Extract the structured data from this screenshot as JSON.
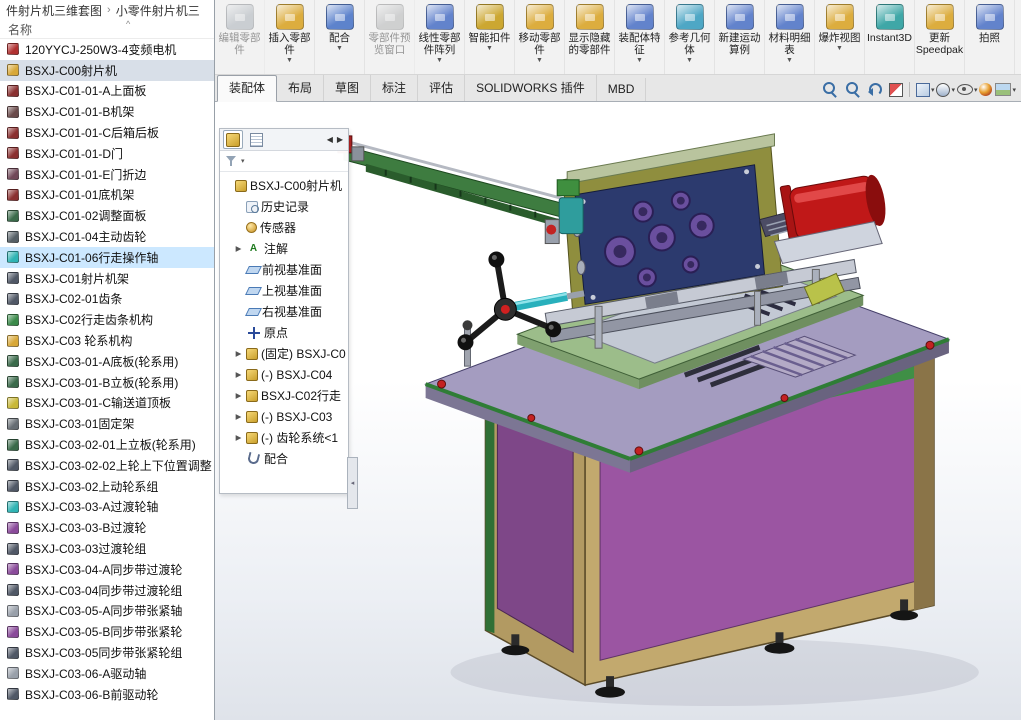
{
  "explorer": {
    "breadcrumb": {
      "seg1": "件射片机三维套图",
      "sep": "›",
      "seg2": "小零件射片机三"
    },
    "name_header": "名称",
    "sort_indicator": "^",
    "files": [
      {
        "label": "120YYCJ-250W3-4变频电机",
        "icon": "part-icon",
        "icon_color": "#b03030",
        "state": "normal"
      },
      {
        "label": "BSXJ-C00射片机",
        "icon": "assembly-icon",
        "icon_color": "#d8a838",
        "state": "selgray"
      },
      {
        "label": "BSXJ-C01-01-A上面板",
        "icon": "part-icon",
        "icon_color": "#8a3030",
        "state": "normal"
      },
      {
        "label": "BSXJ-C01-01-B机架",
        "icon": "part-icon",
        "icon_color": "#6a4a4a",
        "state": "normal"
      },
      {
        "label": "BSXJ-C01-01-C后箱后板",
        "icon": "part-icon",
        "icon_color": "#8a3030",
        "state": "normal"
      },
      {
        "label": "BSXJ-C01-01-D门",
        "icon": "part-icon",
        "icon_color": "#8a3030",
        "state": "normal"
      },
      {
        "label": "BSXJ-C01-01-E门折边",
        "icon": "part-icon",
        "icon_color": "#704858",
        "state": "normal"
      },
      {
        "label": "BSXJ-C01-01底机架",
        "icon": "part-icon",
        "icon_color": "#8a3030",
        "state": "normal"
      },
      {
        "label": "BSXJ-C01-02调整面板",
        "icon": "part-icon",
        "icon_color": "#3a6a4a",
        "state": "normal"
      },
      {
        "label": "BSXJ-C01-04主动齿轮",
        "icon": "part-icon",
        "icon_color": "#555f66",
        "state": "normal"
      },
      {
        "label": "BSXJ-C01-06行走操作轴",
        "icon": "part-icon",
        "icon_color": "#2fb3b3",
        "state": "selected"
      },
      {
        "label": "BSXJ-C01射片机架",
        "icon": "part-icon",
        "icon_color": "#505866",
        "state": "normal"
      },
      {
        "label": "BSXJ-C02-01齿条",
        "icon": "part-icon",
        "icon_color": "#505866",
        "state": "normal"
      },
      {
        "label": "BSXJ-C02行走齿条机构",
        "icon": "assembly-icon",
        "icon_color": "#3a8a4a",
        "state": "normal"
      },
      {
        "label": "BSXJ-C03 轮系机构",
        "icon": "assembly-icon",
        "icon_color": "#d8a838",
        "state": "normal"
      },
      {
        "label": "BSXJ-C03-01-A底板(轮系用)",
        "icon": "part-icon",
        "icon_color": "#3a6a4a",
        "state": "normal"
      },
      {
        "label": "BSXJ-C03-01-B立板(轮系用)",
        "icon": "part-icon",
        "icon_color": "#3a6a4a",
        "state": "normal"
      },
      {
        "label": "BSXJ-C03-01-C输送道顶板",
        "icon": "part-icon",
        "icon_color": "#c8b838",
        "state": "normal"
      },
      {
        "label": "BSXJ-C03-01固定架",
        "icon": "part-icon",
        "icon_color": "#666d73",
        "state": "normal"
      },
      {
        "label": "BSXJ-C03-02-01上立板(轮系用)",
        "icon": "part-icon",
        "icon_color": "#3a6a4a",
        "state": "normal"
      },
      {
        "label": "BSXJ-C03-02-02上轮上下位置调整",
        "icon": "part-icon",
        "icon_color": "#505866",
        "state": "normal"
      },
      {
        "label": "BSXJ-C03-02上动轮系组",
        "icon": "part-icon",
        "icon_color": "#505866",
        "state": "normal"
      },
      {
        "label": "BSXJ-C03-03-A过渡轮轴",
        "icon": "part-icon",
        "icon_color": "#2fb3b3",
        "state": "normal"
      },
      {
        "label": "BSXJ-C03-03-B过渡轮",
        "icon": "part-icon",
        "icon_color": "#8a4a9a",
        "state": "normal"
      },
      {
        "label": "BSXJ-C03-03过渡轮组",
        "icon": "part-icon",
        "icon_color": "#505866",
        "state": "normal"
      },
      {
        "label": "BSXJ-C03-04-A同步带过渡轮",
        "icon": "part-icon",
        "icon_color": "#8a4a9a",
        "state": "normal"
      },
      {
        "label": "BSXJ-C03-04同步带过渡轮组",
        "icon": "part-icon",
        "icon_color": "#505866",
        "state": "normal"
      },
      {
        "label": "BSXJ-C03-05-A同步带张紧轴",
        "icon": "part-icon",
        "icon_color": "#99a0aa",
        "state": "normal"
      },
      {
        "label": "BSXJ-C03-05-B同步带张紧轮",
        "icon": "part-icon",
        "icon_color": "#8a4a9a",
        "state": "normal"
      },
      {
        "label": "BSXJ-C03-05同步带张紧轮组",
        "icon": "part-icon",
        "icon_color": "#505866",
        "state": "normal"
      },
      {
        "label": "BSXJ-C03-06-A驱动轴",
        "icon": "part-icon",
        "icon_color": "#99a0aa",
        "state": "normal"
      },
      {
        "label": "BSXJ-C03-06-B前驱动轮",
        "icon": "part-icon",
        "icon_color": "#505866",
        "state": "normal"
      }
    ]
  },
  "ribbon": {
    "buttons": [
      {
        "name": "edit-component-button",
        "label": "编辑零部件",
        "arrow": "",
        "state": "disabled",
        "icon_color": "#7f9fbf"
      },
      {
        "name": "insert-components-button",
        "label": "插入零部件",
        "arrow": "▼",
        "state": "",
        "icon_color": "#d9a62e"
      },
      {
        "name": "mate-button",
        "label": "配合",
        "arrow": "▼",
        "state": "",
        "icon_color": "#4f78c8"
      },
      {
        "name": "component-preview-window-button",
        "label": "零部件预览窗口",
        "arrow": "",
        "state": "disabled",
        "icon_color": "#9aa0a8"
      },
      {
        "name": "linear-component-pattern-button",
        "label": "线性零部件阵列",
        "arrow": "▼",
        "state": "",
        "icon_color": "#5578c8"
      },
      {
        "name": "smart-fasteners-button",
        "label": "智能扣件",
        "arrow": "▼",
        "state": "",
        "icon_color": "#c8a020"
      },
      {
        "name": "move-component-button",
        "label": "移动零部件",
        "arrow": "▼",
        "state": "",
        "icon_color": "#d9a62e"
      },
      {
        "name": "show-hidden-components-button",
        "label": "显示隐藏的零部件",
        "arrow": "",
        "state": "",
        "icon_color": "#d9a62e"
      },
      {
        "name": "assembly-features-button",
        "label": "装配体特征",
        "arrow": "▼",
        "state": "",
        "icon_color": "#5578c8"
      },
      {
        "name": "reference-geometry-button",
        "label": "参考几何体",
        "arrow": "▼",
        "state": "",
        "icon_color": "#3f9fc0"
      },
      {
        "name": "new-motion-study-button",
        "label": "新建运动算例",
        "arrow": "",
        "state": "",
        "icon_color": "#5578c8"
      },
      {
        "name": "bill-of-materials-button",
        "label": "材料明细表",
        "arrow": "▼",
        "state": "",
        "icon_color": "#5578c8"
      },
      {
        "name": "exploded-view-button",
        "label": "爆炸视图",
        "arrow": "▼",
        "state": "",
        "icon_color": "#d9a62e"
      },
      {
        "name": "instant3d-button",
        "label": "Instant3D",
        "arrow": "",
        "state": "",
        "icon_color": "#2fa0a0"
      },
      {
        "name": "update-speedpak-button",
        "label": "更新 Speedpak",
        "arrow": "",
        "state": "",
        "icon_color": "#d9a62e"
      },
      {
        "name": "take-snapshot-button",
        "label": "拍照",
        "arrow": "",
        "state": "",
        "icon_color": "#5578c8"
      }
    ],
    "tabs": [
      {
        "label": "装配体",
        "state": "active"
      },
      {
        "label": "布局",
        "state": ""
      },
      {
        "label": "草图",
        "state": ""
      },
      {
        "label": "标注",
        "state": ""
      },
      {
        "label": "评估",
        "state": ""
      },
      {
        "label": "SOLIDWORKS 插件",
        "state": ""
      },
      {
        "label": "MBD",
        "state": ""
      }
    ]
  },
  "viewbar": {
    "icons": [
      {
        "name": "zoom-fit-icon",
        "cls": "ic-mag",
        "arrow": ""
      },
      {
        "name": "zoom-area-icon",
        "cls": "ic-mag",
        "arrow": ""
      },
      {
        "name": "previous-view-icon",
        "cls": "ic-prev",
        "arrow": ""
      },
      {
        "name": "section-view-icon",
        "cls": "ic-section",
        "arrow": ""
      },
      {
        "name": "separator",
        "cls": "vsep",
        "arrow": ""
      },
      {
        "name": "view-orientation-icon",
        "cls": "ic-cube",
        "arrow": "▾"
      },
      {
        "name": "display-style-icon",
        "cls": "ic-style",
        "arrow": "▾"
      },
      {
        "name": "hide-show-items-icon",
        "cls": "ic-eye",
        "arrow": "▾"
      },
      {
        "name": "edit-appearance-icon",
        "cls": "ic-ball",
        "arrow": ""
      },
      {
        "name": "apply-scene-icon",
        "cls": "ic-scene",
        "arrow": "▾"
      }
    ]
  },
  "feature_panel": {
    "tabs": [
      {
        "name": "featuremanager-tree-tab",
        "cls": "pt-asm",
        "state": "active"
      },
      {
        "name": "propertymanager-tab",
        "cls": "pt-prop",
        "state": ""
      }
    ],
    "scroll_left": "◀",
    "scroll_right": "▶",
    "filter_arrow": "▾",
    "handle": "◂",
    "tree": [
      {
        "label": "BSXJ-C00射片机",
        "icon": "assembly-icon",
        "cls": "t-asm",
        "exp": "",
        "lvl": "lvl0"
      },
      {
        "label": "历史记录",
        "icon": "history-folder-icon",
        "cls": "t-hist",
        "exp": "",
        "lvl": "lvl1"
      },
      {
        "label": "传感器",
        "icon": "sensors-icon",
        "cls": "t-sens",
        "exp": "",
        "lvl": "lvl1"
      },
      {
        "label": "注解",
        "icon": "annotations-icon",
        "cls": "t-ann",
        "exp": "▶",
        "lvl": "lvl1"
      },
      {
        "label": "前视基准面",
        "icon": "plane-icon",
        "cls": "t-plane",
        "exp": "",
        "lvl": "lvl1"
      },
      {
        "label": "上视基准面",
        "icon": "plane-icon",
        "cls": "t-plane",
        "exp": "",
        "lvl": "lvl1"
      },
      {
        "label": "右视基准面",
        "icon": "plane-icon",
        "cls": "t-plane",
        "exp": "",
        "lvl": "lvl1"
      },
      {
        "label": "原点",
        "icon": "origin-icon",
        "cls": "t-origin",
        "exp": "",
        "lvl": "lvl1"
      },
      {
        "label": "(固定) BSXJ-C0",
        "icon": "component-icon",
        "cls": "t-asm",
        "exp": "▶",
        "lvl": "lvl1"
      },
      {
        "label": "(-) BSXJ-C04",
        "icon": "component-icon",
        "cls": "t-asm",
        "exp": "▶",
        "lvl": "lvl1"
      },
      {
        "label": "BSXJ-C02行走",
        "icon": "component-icon",
        "cls": "t-asm",
        "exp": "▶",
        "lvl": "lvl1"
      },
      {
        "label": "(-) BSXJ-C03 ",
        "icon": "component-icon",
        "cls": "t-asm",
        "exp": "▶",
        "lvl": "lvl1"
      },
      {
        "label": "(-) 齿轮系统<1",
        "icon": "component-icon",
        "cls": "t-asm",
        "exp": "▶",
        "lvl": "lvl1"
      },
      {
        "label": "配合",
        "icon": "mates-icon",
        "cls": "t-mate",
        "exp": "",
        "lvl": "lvl1"
      }
    ]
  },
  "viewport": {
    "colors": {
      "cabinet_frame": "#c2a96e",
      "cabinet_panel": "#9b55a2",
      "trim_green": "#3f8f46",
      "tabletop": "#a49cc0",
      "motor_red": "#c01818",
      "mechanism_plate": "#2c3a6e",
      "gear_purple": "#6a4f9e",
      "shaft_teal": "#28b0bc"
    }
  }
}
